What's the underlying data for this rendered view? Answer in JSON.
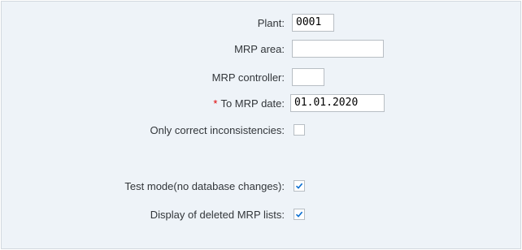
{
  "form": {
    "plant_label": "Plant:",
    "plant_value": "0001",
    "mrp_area_label": "MRP area:",
    "mrp_area_value": "",
    "mrp_controller_label": "MRP controller:",
    "mrp_controller_value": "",
    "to_mrp_date_required": "*",
    "to_mrp_date_label": "To MRP date:",
    "to_mrp_date_value": "01.01.2020",
    "only_correct_label": "Only correct inconsistencies:",
    "only_correct_checked": false,
    "test_mode_label": "Test mode(no database changes):",
    "test_mode_checked": true,
    "display_deleted_label": "Display of deleted MRP lists:",
    "display_deleted_checked": true
  },
  "colors": {
    "background": "#eef3f8",
    "required_marker": "#e00000",
    "checkmark": "#0a6ed1"
  }
}
